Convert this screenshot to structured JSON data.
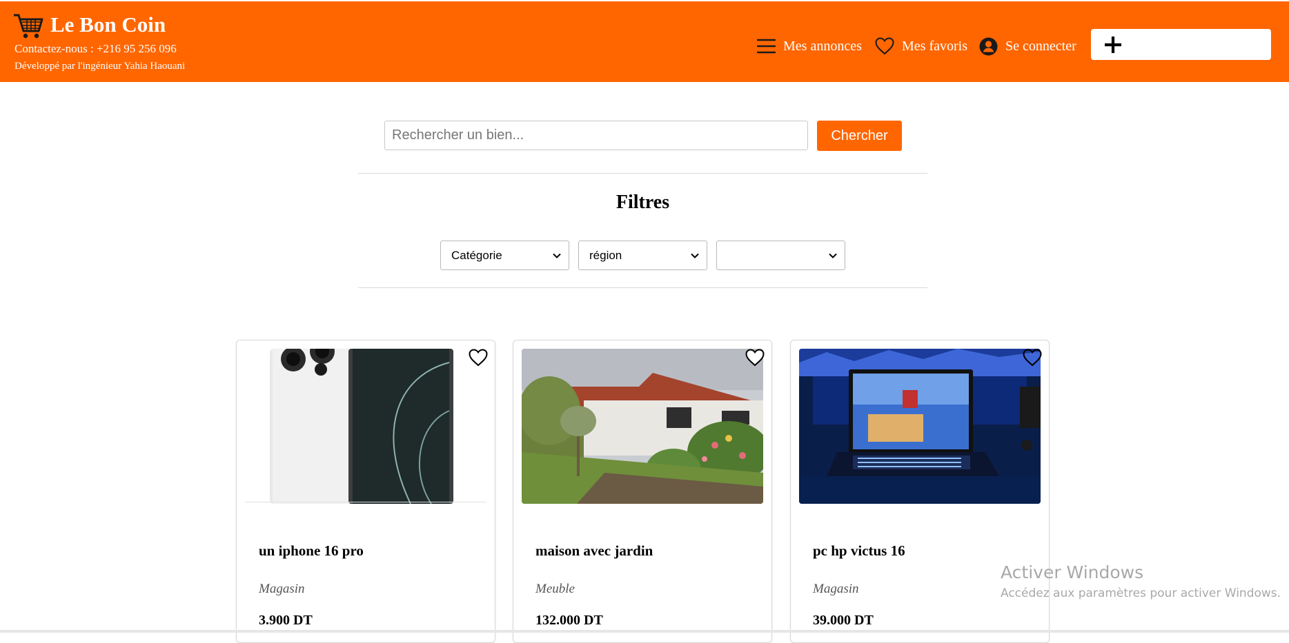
{
  "colors": {
    "brand": "#ff6600",
    "white": "#ffffff"
  },
  "header": {
    "logo_icon": "shopping-cart-icon",
    "title": "Le Bon Coin",
    "contact": "Contactez-nous : +216 95 256 096",
    "developer": "Développé par l'ingénieur Yahia Haouani",
    "nav": {
      "annonces": {
        "icon": "hamburger-menu-icon",
        "label": "Mes annonces"
      },
      "favoris": {
        "icon": "heart-outline-icon",
        "label": "Mes favoris"
      },
      "login": {
        "icon": "user-circle-icon",
        "label": "Se connecter"
      }
    },
    "add_button_icon": "plus-icon"
  },
  "search": {
    "placeholder": "Rechercher un bien...",
    "value": "",
    "button_label": "Chercher"
  },
  "filters": {
    "title": "Filtres",
    "category": "Catégorie",
    "region": "région",
    "third": ""
  },
  "listings": [
    {
      "title": "un iphone 16 pro",
      "category": "Magasin",
      "price": "3.900 DT",
      "image": "iphone-photo"
    },
    {
      "title": "maison avec jardin",
      "category": "Meuble",
      "price": "132.000 DT",
      "image": "house-garden-photo"
    },
    {
      "title": "pc hp victus 16",
      "category": "Magasin",
      "price": "39.000 DT",
      "image": "gaming-laptop-photo"
    }
  ],
  "watermark": {
    "title": "Activer Windows",
    "subtitle": "Accédez aux paramètres pour activer Windows."
  }
}
